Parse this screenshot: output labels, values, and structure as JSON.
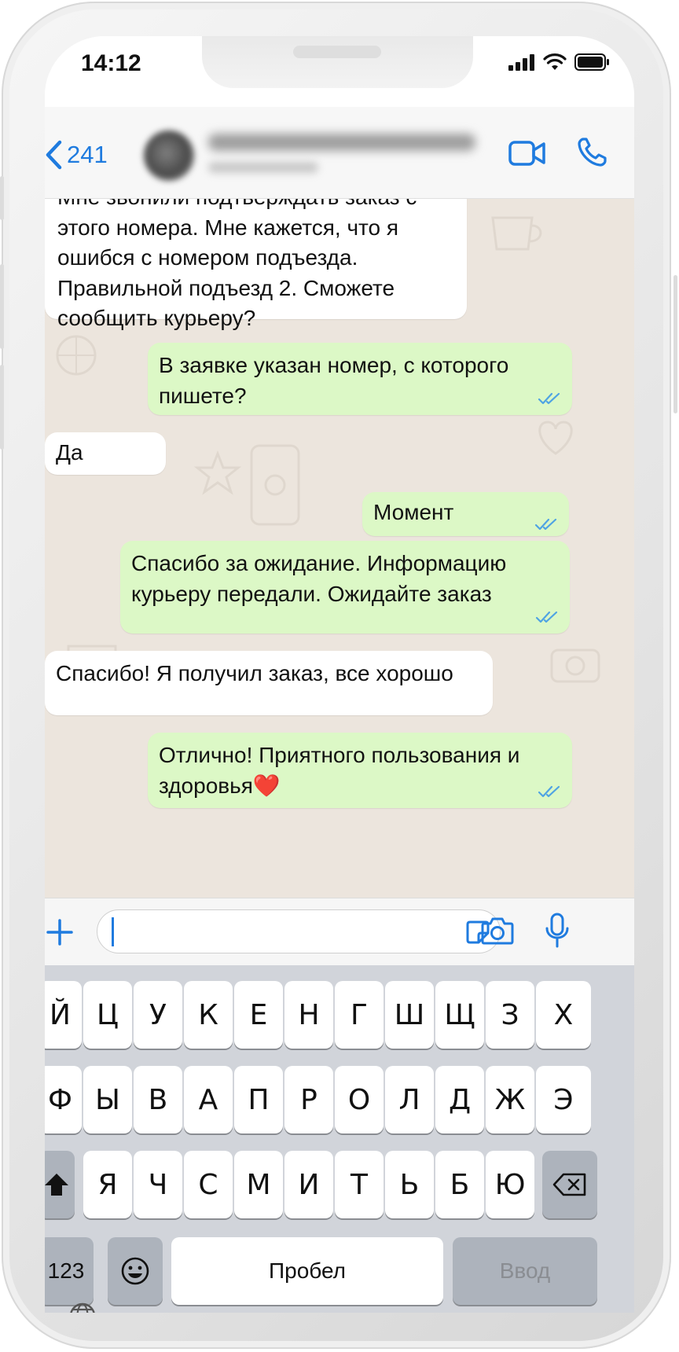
{
  "status_bar": {
    "time": "14:12"
  },
  "header": {
    "back_count": "241"
  },
  "messages": [
    {
      "side": "in",
      "text": "Мне звонили подтверждать заказ с\nэтого номера. Мне кажется, что я\nошибся с номером подъезда.\nПравильной подъезд 2. Сможете\nсообщить курьеру?"
    },
    {
      "side": "out",
      "text": "В заявке указан номер, с которого\nпишете?",
      "read": true
    },
    {
      "side": "in",
      "text": "Да"
    },
    {
      "side": "out",
      "text": "Момент",
      "read": true
    },
    {
      "side": "out",
      "text": "Спасибо за ожидание. Информацию\nкурьеру передали. Ожидайте заказ",
      "read": true
    },
    {
      "side": "in",
      "text": "Спасибо! Я получил заказ, все хорошо"
    },
    {
      "side": "out",
      "text": "Отлично! Приятного пользования и\nздоровья❤️",
      "read": true
    }
  ],
  "input": {
    "value": ""
  },
  "keyboard": {
    "row1": [
      "Й",
      "Ц",
      "У",
      "К",
      "Е",
      "Н",
      "Г",
      "Ш",
      "Щ",
      "З",
      "Х"
    ],
    "row2": [
      "Ф",
      "Ы",
      "В",
      "А",
      "П",
      "Р",
      "О",
      "Л",
      "Д",
      "Ж",
      "Э"
    ],
    "row3": [
      "Я",
      "Ч",
      "С",
      "М",
      "И",
      "Т",
      "Ь",
      "Б",
      "Ю"
    ],
    "numbers_label": "123",
    "space_label": "Пробел",
    "return_label": "Ввод"
  },
  "colors": {
    "accent": "#1f7bdf",
    "outgoing_bubble": "#dcf8c6",
    "incoming_bubble": "#ffffff",
    "chat_bg": "#ece5dd",
    "read_ticks": "#4fa3e3"
  },
  "icons": [
    "chevron-left-icon",
    "video-call-icon",
    "phone-icon",
    "plus-icon",
    "sticker-icon",
    "camera-icon",
    "microphone-icon",
    "shift-icon",
    "backspace-icon",
    "emoji-icon",
    "globe-icon"
  ]
}
